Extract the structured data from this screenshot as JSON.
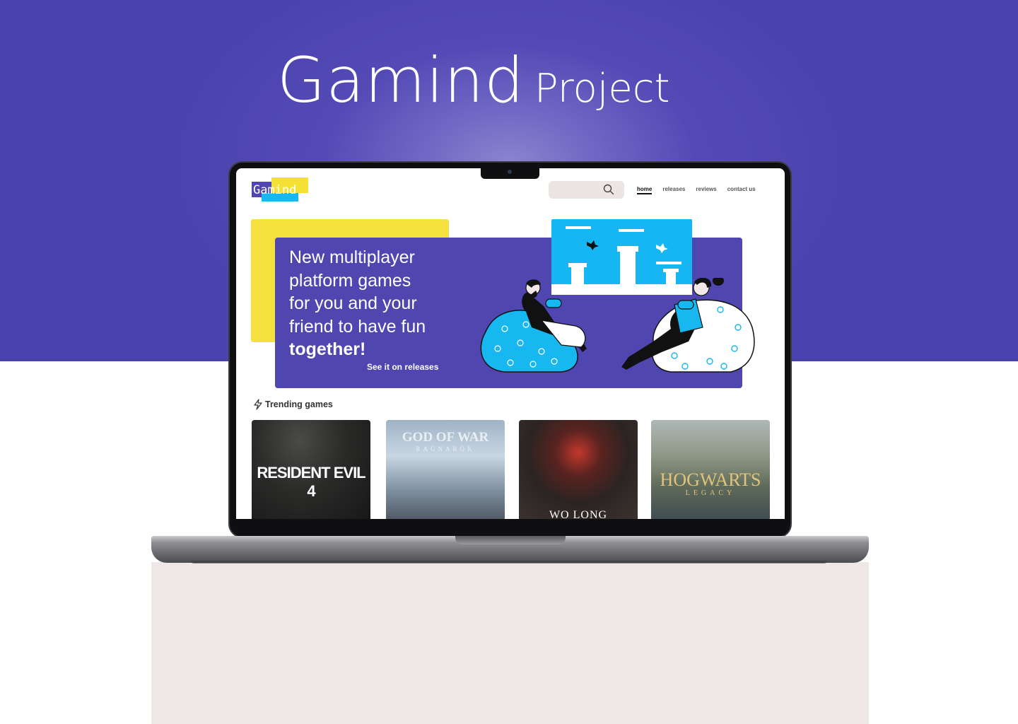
{
  "showcase": {
    "title_main": "Gamind",
    "title_sub": "Project"
  },
  "site": {
    "logo_text": "Gamind",
    "nav": {
      "home": "home",
      "releases": "releases",
      "reviews": "reviews",
      "contact": "contact us"
    },
    "hero": {
      "line1": "New multiplayer",
      "line2": "platform games",
      "line3": "for you and your",
      "line4": "friend to have fun",
      "line5": "together!",
      "link": "See it on releases"
    },
    "trending_title": "Trending games",
    "games": [
      {
        "title": "RESIDENT EVIL 4"
      },
      {
        "title": "GOD OF WAR",
        "subtitle": "RAGNARÖK"
      },
      {
        "title": "WO LONG"
      },
      {
        "title": "HOGWARTS",
        "subtitle": "LEGACY"
      }
    ]
  },
  "colors": {
    "banner": "#4a43ad",
    "hero": "#4f46b0",
    "accent_yellow": "#f5e13d",
    "accent_cyan": "#16b6f2"
  },
  "icons": [
    "search-icon",
    "lightning-icon",
    "bird-icon"
  ]
}
